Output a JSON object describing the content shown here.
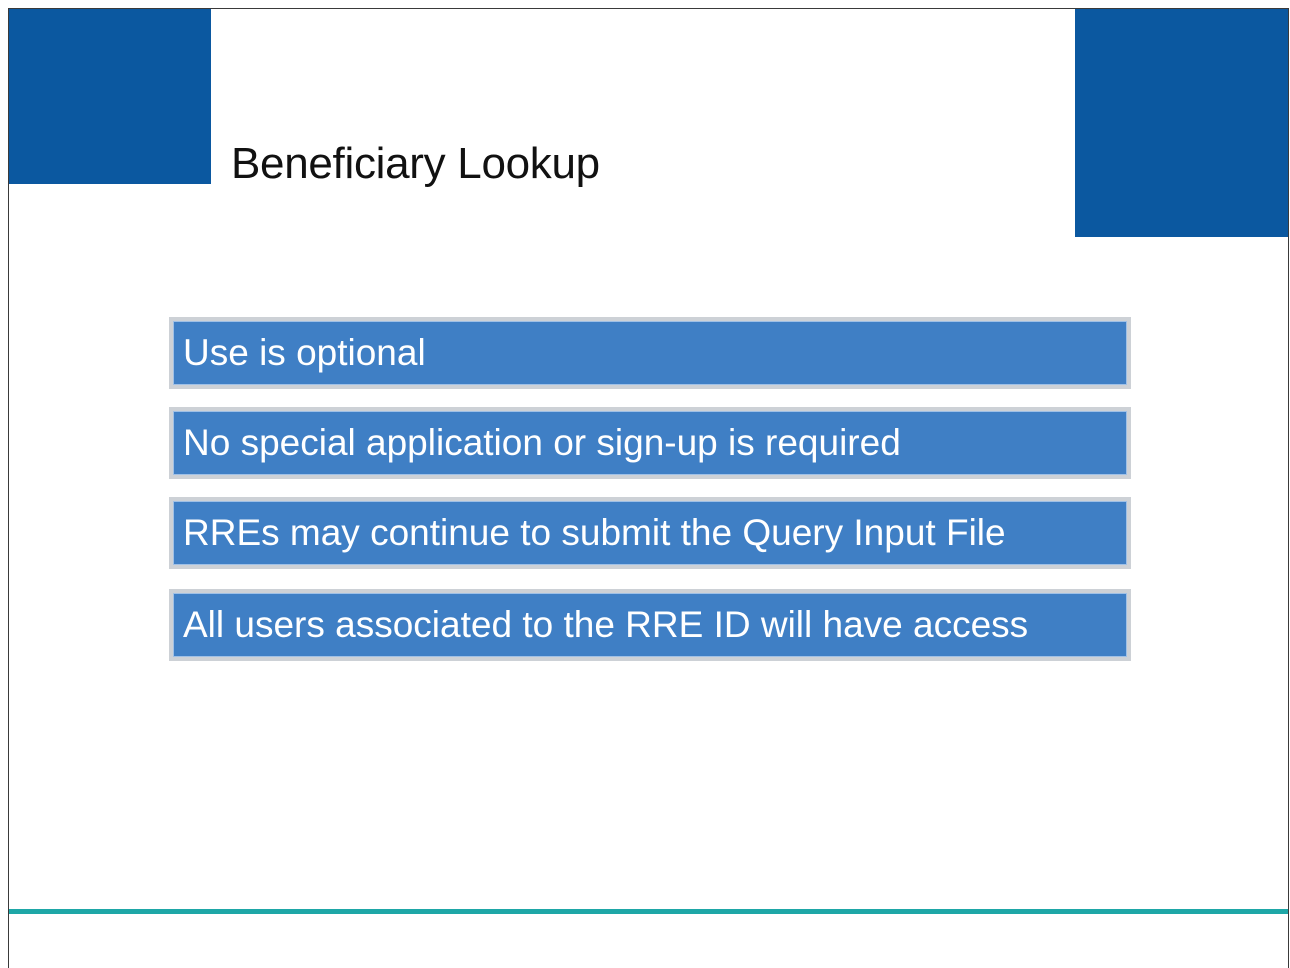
{
  "slide": {
    "title": "Beneficiary Lookup",
    "bullets": [
      "Use is optional",
      "No special application or sign-up is required",
      "RREs may continue to submit the Query Input File",
      "All users associated to the RRE ID will have access"
    ]
  },
  "colors": {
    "corner_blocks": "#0b58a0",
    "bullet_fill": "#3f7fc5",
    "bullet_border": "#cdd1d6",
    "bottom_line": "#1ea7a7"
  }
}
